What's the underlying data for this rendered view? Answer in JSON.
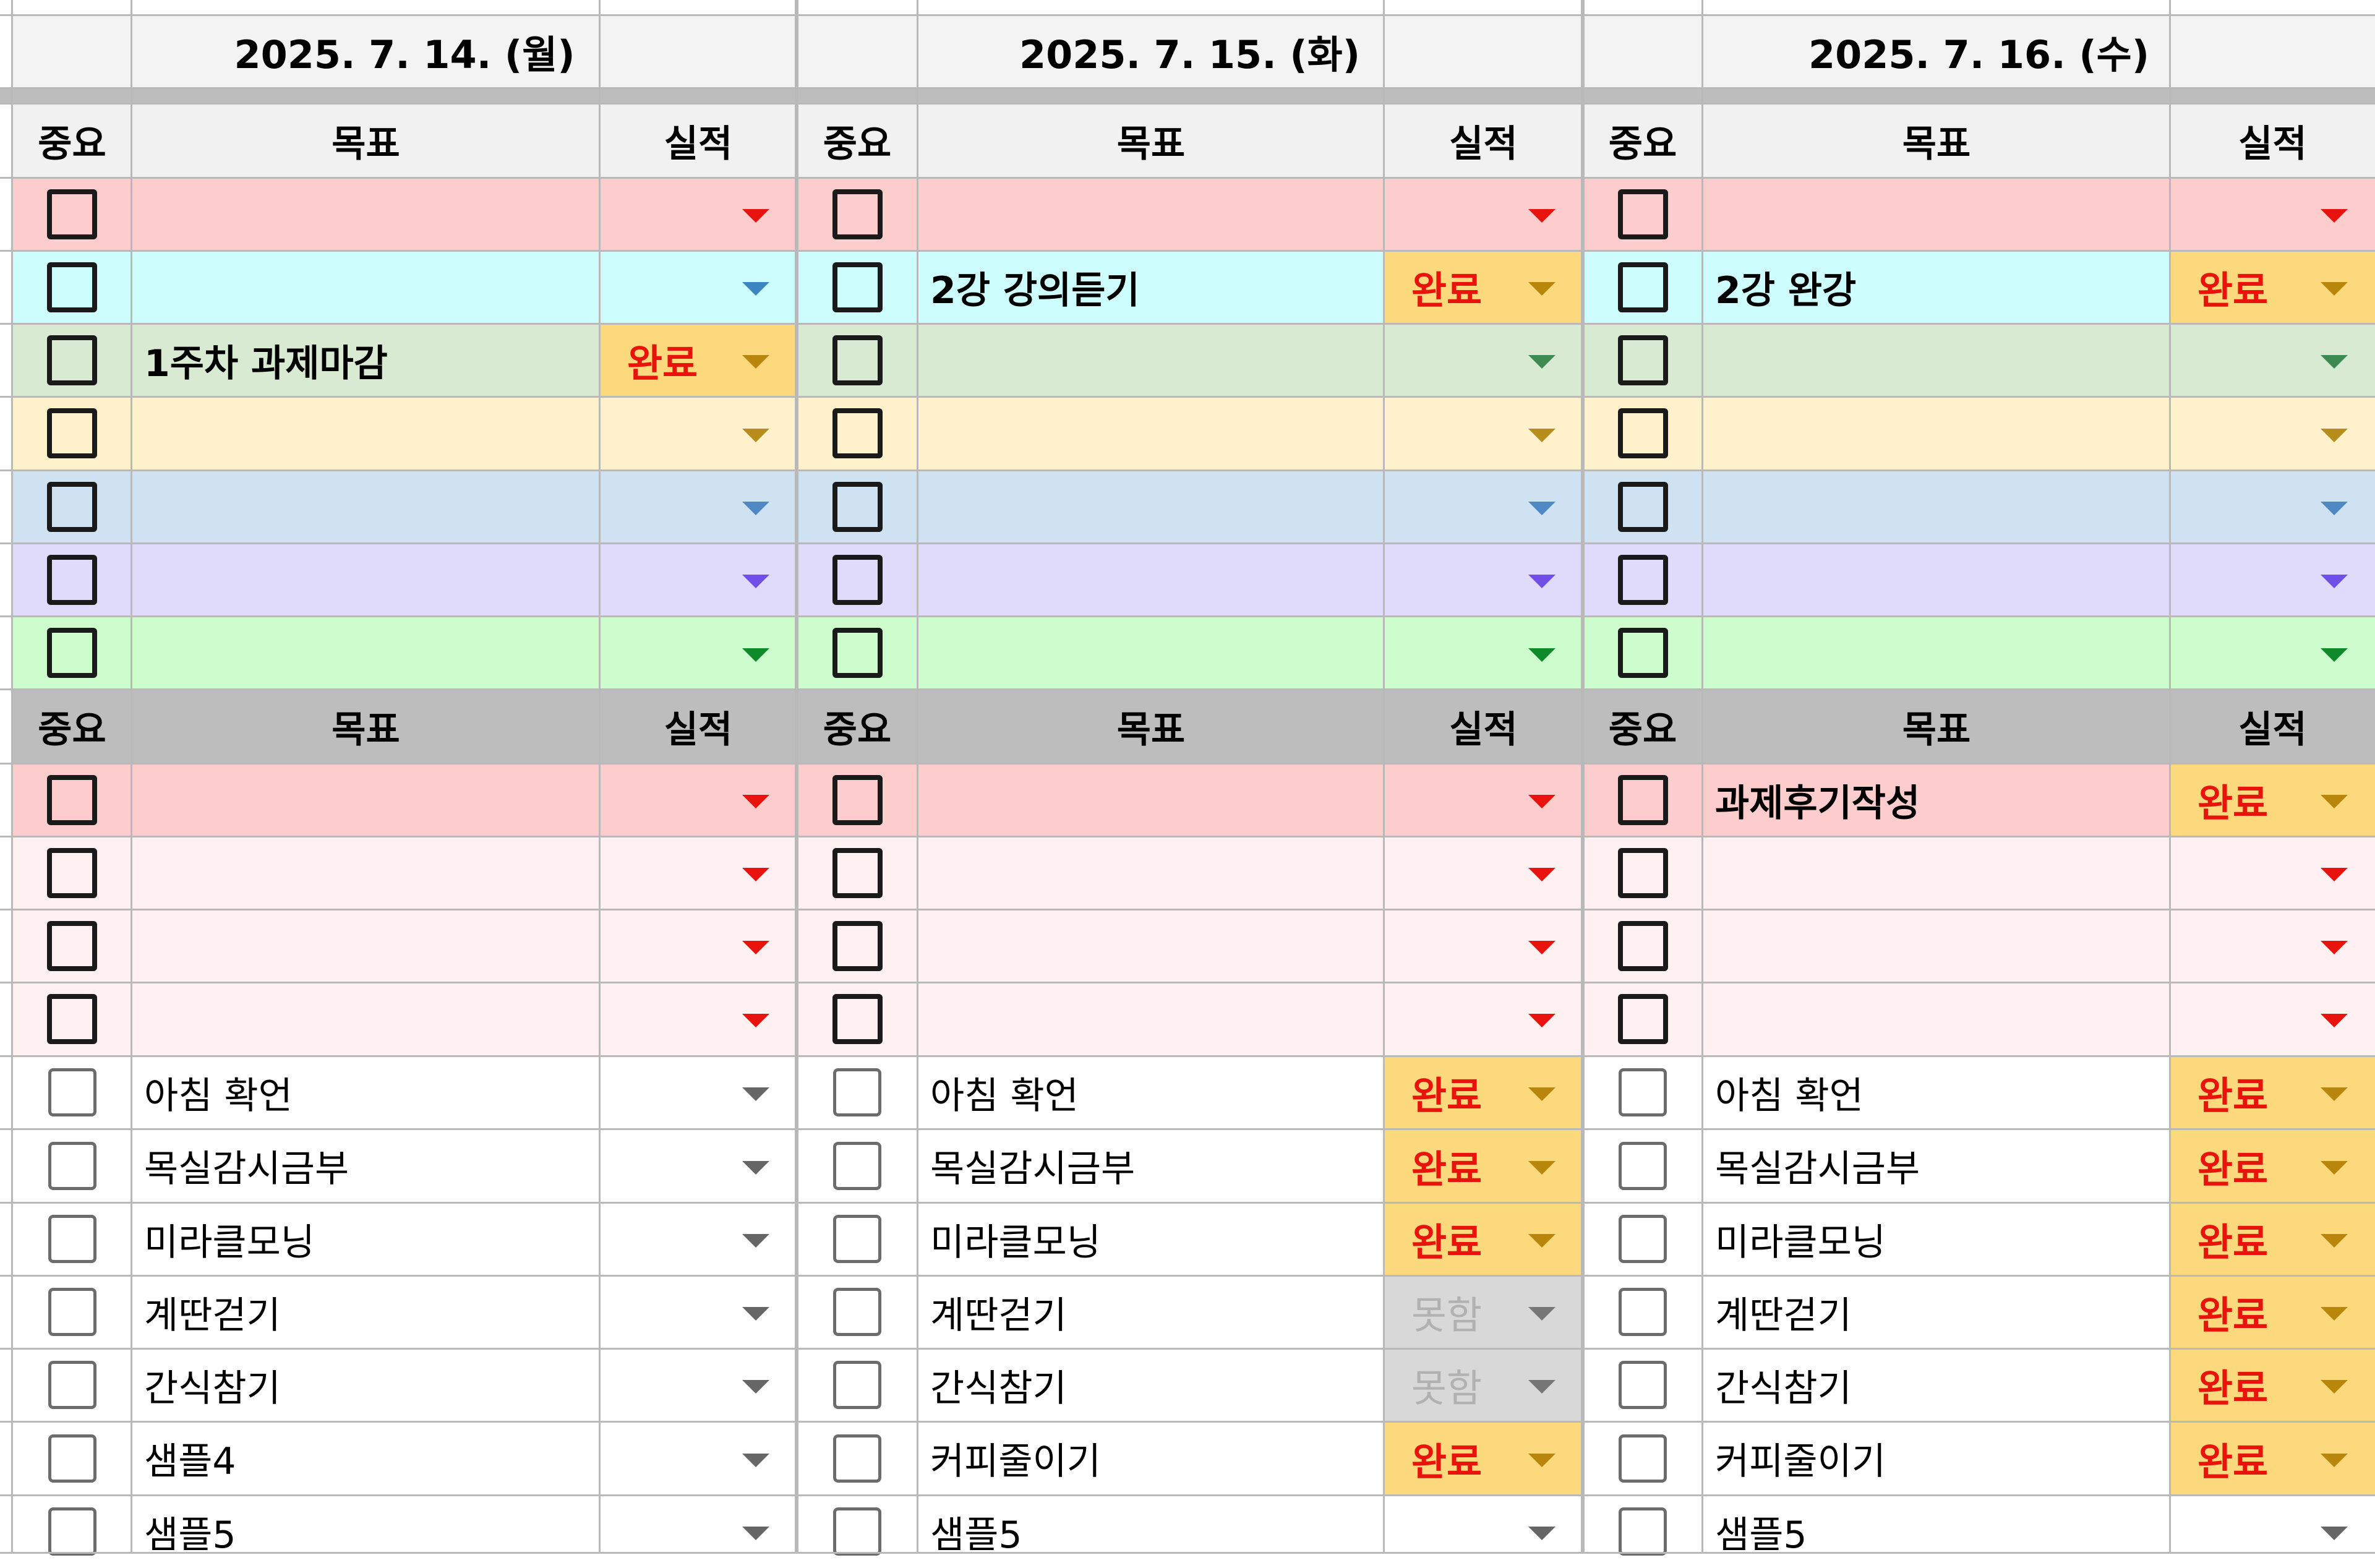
{
  "dates": [
    "2025. 7. 14. (월)",
    "2025. 7. 15. (화)",
    "2025. 7. 16. (수)"
  ],
  "headers": {
    "importance": "중요",
    "goal": "목표",
    "result": "실적"
  },
  "colors": {
    "red": "#fdcccc",
    "cyan": "#cdfdfd",
    "green": "#d9ead3",
    "yellow": "#fef1cc",
    "blue": "#cfe2f2",
    "purple": "#e0dafb",
    "lime": "#cdfdcd",
    "pink": "#fff1f1",
    "gray_header": "#bdbdbd",
    "done": "#fcd97c",
    "notdone": "#d8d8d8",
    "arrow_red": "#e8130c",
    "arrow_cyan": "#3c86c2",
    "arrow_green": "#3e8b52",
    "arrow_yellow": "#b78d1c",
    "arrow_blue": "#4f88c4",
    "arrow_purple": "#6f4fe5",
    "arrow_lime": "#0f8a2b",
    "arrow_gray": "#666666"
  },
  "days": [
    {
      "goals": [
        "",
        "",
        "1주차 과제마감",
        "",
        "",
        "",
        ""
      ],
      "results": [
        "",
        "",
        "완료",
        "",
        "",
        "",
        ""
      ],
      "second_goals": [
        "",
        "",
        "",
        ""
      ],
      "second_results": [
        "",
        "",
        "",
        ""
      ],
      "routines": [
        "아침 확언",
        "목실감시금부",
        "미라클모닝",
        "계딴걷기",
        "간식참기",
        "샘플4",
        "샘플5"
      ],
      "routine_results": [
        "",
        "",
        "",
        "",
        "",
        "",
        ""
      ]
    },
    {
      "goals": [
        "",
        "2강 강의듣기",
        "",
        "",
        "",
        "",
        ""
      ],
      "results": [
        "",
        "완료",
        "",
        "",
        "",
        "",
        ""
      ],
      "second_goals": [
        "",
        "",
        "",
        ""
      ],
      "second_results": [
        "",
        "",
        "",
        ""
      ],
      "routines": [
        "아침 확언",
        "목실감시금부",
        "미라클모닝",
        "계딴걷기",
        "간식참기",
        "커피줄이기",
        "샘플5"
      ],
      "routine_results": [
        "완료",
        "완료",
        "완료",
        "못함",
        "못함",
        "완료",
        ""
      ]
    },
    {
      "goals": [
        "",
        "2강 완강",
        "",
        "",
        "",
        "",
        ""
      ],
      "results": [
        "",
        "완료",
        "",
        "",
        "",
        "",
        ""
      ],
      "second_goals": [
        "과제후기작성",
        "",
        "",
        ""
      ],
      "second_results": [
        "완료",
        "",
        "",
        ""
      ],
      "routines": [
        "아침 확언",
        "목실감시금부",
        "미라클모닝",
        "계딴걷기",
        "간식참기",
        "커피줄이기",
        "샘플5"
      ],
      "routine_results": [
        "완료",
        "완료",
        "완료",
        "완료",
        "완료",
        "완료",
        ""
      ]
    }
  ]
}
